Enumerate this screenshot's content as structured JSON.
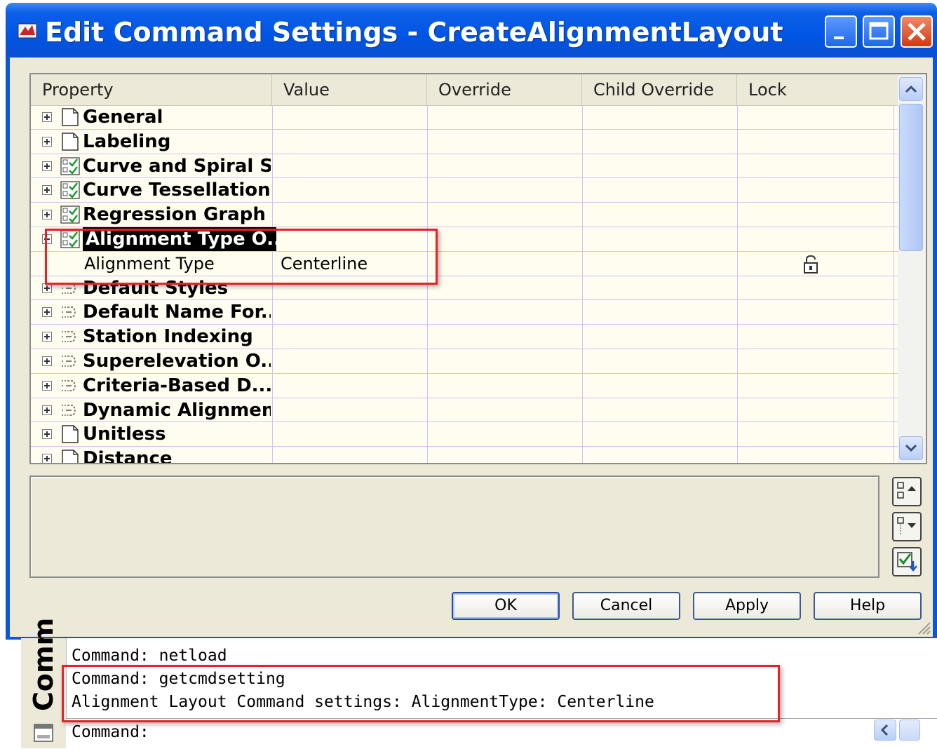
{
  "window": {
    "title": "Edit Command Settings - CreateAlignmentLayout"
  },
  "grid": {
    "columns": [
      "Property",
      "Value",
      "Override",
      "Child Override",
      "Lock"
    ],
    "rows": [
      {
        "label": "General",
        "icon": "document-icon",
        "expander": "plus",
        "value": ""
      },
      {
        "label": "Labeling",
        "icon": "document-icon",
        "expander": "plus",
        "value": ""
      },
      {
        "label": "Curve and Spiral S...",
        "icon": "checked-grid-icon",
        "expander": "plus",
        "value": ""
      },
      {
        "label": "Curve Tessellation...",
        "icon": "checked-grid-icon",
        "expander": "plus",
        "value": ""
      },
      {
        "label": "Regression Graph ...",
        "icon": "checked-grid-icon",
        "expander": "plus",
        "value": ""
      },
      {
        "label": "Alignment Type O...",
        "icon": "checked-grid-icon",
        "expander": "minus",
        "value": "",
        "selected": true
      },
      {
        "label": "Alignment Type",
        "child": true,
        "value": "Centerline",
        "locked": true
      },
      {
        "label": "Default Styles",
        "icon": "dashed-arrow-icon",
        "expander": "plus",
        "value": ""
      },
      {
        "label": "Default Name For...",
        "icon": "dashed-arrow-icon",
        "expander": "plus",
        "value": ""
      },
      {
        "label": "Station Indexing",
        "icon": "dashed-arrow-icon",
        "expander": "plus",
        "value": ""
      },
      {
        "label": "Superelevation O...",
        "icon": "dashed-arrow-icon",
        "expander": "plus",
        "value": ""
      },
      {
        "label": "Criteria-Based D...",
        "icon": "dashed-arrow-icon",
        "expander": "plus",
        "value": ""
      },
      {
        "label": "Dynamic Alignmen...",
        "icon": "dashed-arrow-icon",
        "expander": "plus",
        "value": ""
      },
      {
        "label": "Unitless",
        "icon": "document-icon",
        "expander": "plus",
        "value": ""
      },
      {
        "label": "Distance",
        "icon": "document-icon",
        "expander": "plus",
        "value": ""
      }
    ]
  },
  "buttons": {
    "ok": "OK",
    "cancel": "Cancel",
    "apply": "Apply",
    "help": "Help"
  },
  "command_line": {
    "side_label": "Comm",
    "lines": [
      "Command: netload",
      "Command: getcmdsetting",
      "Alignment Layout Command settings: AlignmentType: Centerline"
    ],
    "prompt": "Command:"
  },
  "colors": {
    "highlight": "#e8202a",
    "titlebar": "#0055e5",
    "grid_bg": "#fffdf0"
  }
}
